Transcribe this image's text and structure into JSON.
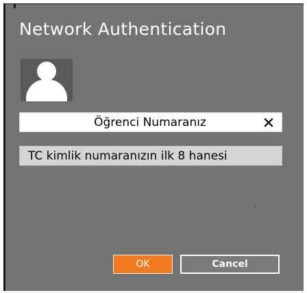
{
  "dialog": {
    "title": "Network Authentication"
  },
  "icons": {
    "avatar": "user-silhouette-icon",
    "clear": "close-x-icon"
  },
  "fields": {
    "username": {
      "value": "Öğrenci Numaranız"
    },
    "password": {
      "value": "TC kimlik numaranızın ilk 8 hanesi"
    }
  },
  "buttons": {
    "ok_label": "OK",
    "cancel_label": "Cancel"
  },
  "colors": {
    "dialog_background": "#737373",
    "accent_ok": "#f27a21",
    "field_username_bg": "#ffffff",
    "field_password_bg": "#d4d4d4"
  }
}
